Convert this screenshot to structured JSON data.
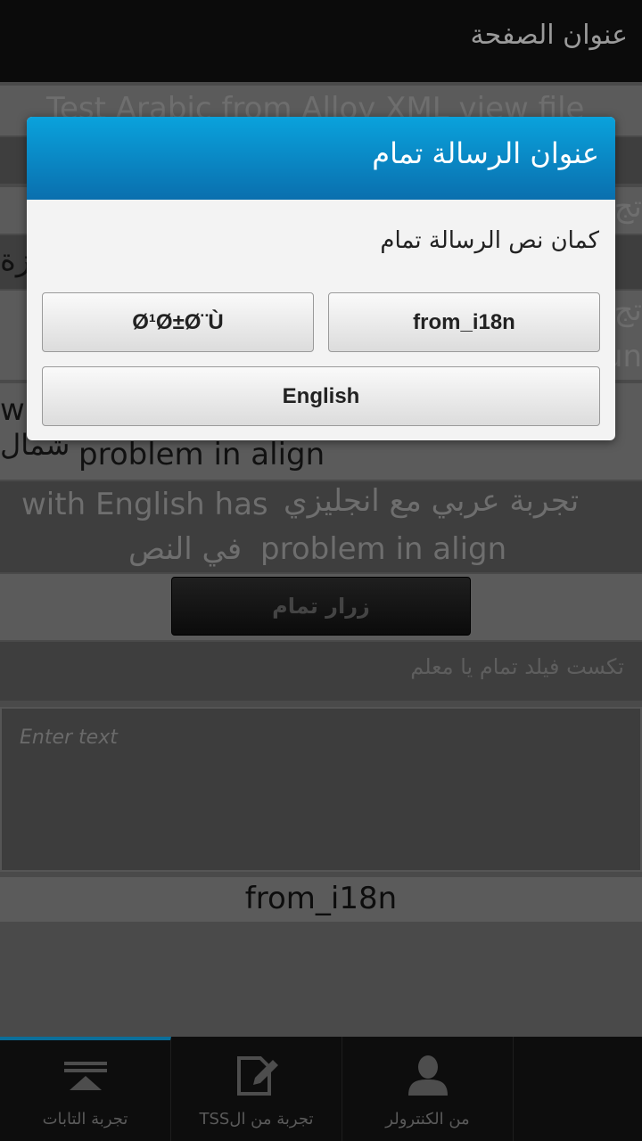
{
  "page": {
    "title": "عنوان الصفحة"
  },
  "rows": {
    "xml_text": "Test Arabic from Alloy XML view file",
    "frag_tagreba": "تج",
    "frag_za": "زة",
    "frag_un": "un",
    "frag_w": "w",
    "black_line2_ar": "شمال",
    "black_line2_en": "problem in align",
    "grey_line1_en": "with English has",
    "grey_line1_ar": "تجربة عربي مع انجليزي",
    "grey_line2_ar": "في النص",
    "grey_line2_en": "problem in align"
  },
  "bg_button": {
    "label": "زرار تمام"
  },
  "textfield_label": "تكست فيلد تمام يا معلم",
  "textarea": {
    "placeholder": "Enter text"
  },
  "i18n_label": "from_i18n",
  "tabs": [
    {
      "label": "تجربة التابات",
      "icon": "tab-stack-icon",
      "active": true
    },
    {
      "label": "تجربة من الTSS",
      "icon": "edit-note-icon",
      "active": false
    },
    {
      "label": "من الكنترولر",
      "icon": "person-icon",
      "active": false
    }
  ],
  "dialog": {
    "title": "عنوان الرسالة تمام",
    "message": "كمان نص الرسالة تمام",
    "buttons": {
      "garbled": "Ø¹Ø±Ø¨Ù",
      "i18n": "from_i18n",
      "english": "English"
    }
  },
  "colors": {
    "dialog_header_top": "#0aa2dc",
    "dialog_header_bottom": "#0a6fae",
    "tab_active": "#0a6e9a"
  }
}
